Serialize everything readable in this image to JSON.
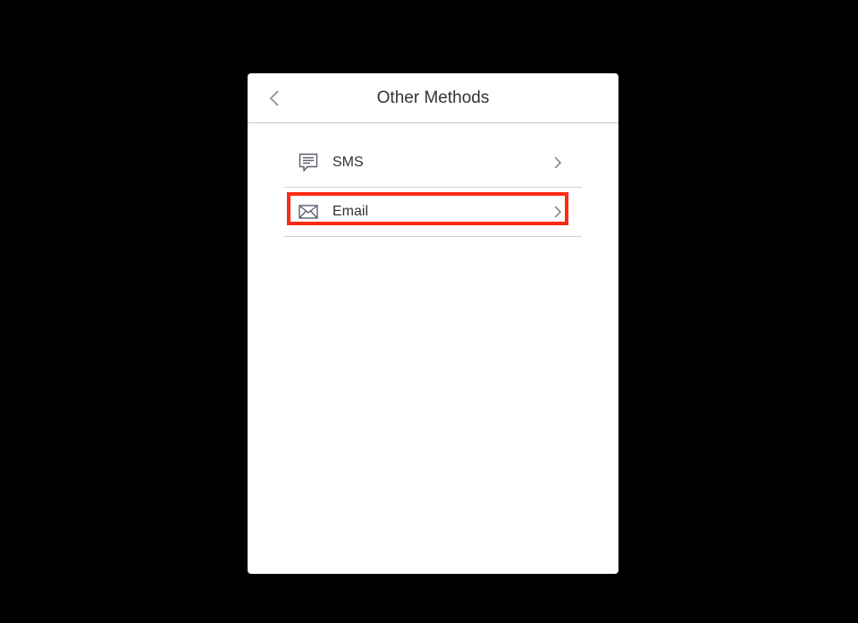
{
  "header": {
    "title": "Other Methods",
    "back_icon": "chevron-left-icon"
  },
  "methods": [
    {
      "label": "SMS",
      "icon": "message-icon",
      "chevron": "chevron-right-icon"
    },
    {
      "label": "Email",
      "icon": "envelope-icon",
      "chevron": "chevron-right-icon"
    }
  ],
  "colors": {
    "background": "#000000",
    "card": "#ffffff",
    "text": "#333333",
    "icon": "#5a5f6e",
    "divider": "#cfcfcf",
    "highlight": "#ff2a12"
  }
}
